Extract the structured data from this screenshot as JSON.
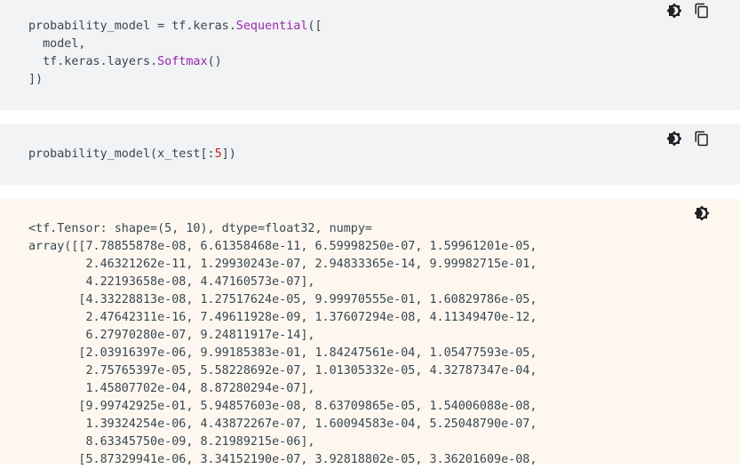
{
  "code_block_1": {
    "line1_pre": "probability_model = tf.keras.",
    "line1_kw": "Sequential",
    "line1_post": "([",
    "line2": "  model,",
    "line3_pre": "  tf.keras.layers.",
    "line3_kw": "Softmax",
    "line3_post": "()",
    "line4": "])"
  },
  "code_block_2": {
    "pre": "probability_model(x_test[:",
    "num": "5",
    "post": "])"
  },
  "output_block": {
    "text": "<tf.Tensor: shape=(5, 10), dtype=float32, numpy=\narray([[7.78855878e-08, 6.61358468e-11, 6.59998250e-07, 1.59961201e-05,\n        2.46321262e-11, 1.29930243e-07, 2.94833365e-14, 9.99982715e-01,\n        4.22193658e-08, 4.47160573e-07],\n       [4.33228813e-08, 1.27517624e-05, 9.99970555e-01, 1.60829786e-05,\n        2.47642311e-16, 7.49611928e-09, 1.37607294e-08, 4.11349470e-12,\n        6.27970280e-07, 9.24811917e-14],\n       [2.03916397e-06, 9.99185383e-01, 1.84247561e-04, 1.05477593e-05,\n        2.75765397e-05, 5.58228692e-07, 1.01305332e-05, 4.32787347e-04,\n        1.45807702e-04, 8.87280294e-07],\n       [9.99742925e-01, 5.94857603e-08, 8.63709865e-05, 1.54006088e-08,\n        1.39324254e-06, 4.43872267e-07, 1.60094583e-04, 5.25048790e-07,\n        8.63345750e-09, 8.21989215e-06],\n       [5.87329941e-06, 3.34152190e-07, 3.92818802e-05, 3.36201609e-08,"
  },
  "icons": {
    "theme_toggle": "brightness-icon",
    "copy": "copy-icon"
  }
}
